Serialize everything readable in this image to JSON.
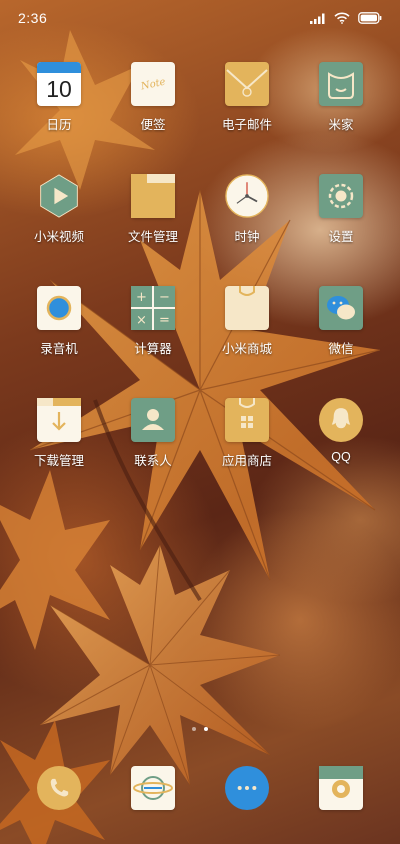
{
  "status_bar": {
    "time": "2:36",
    "icons": [
      "signal-icon",
      "wifi-icon",
      "battery-icon"
    ]
  },
  "apps": [
    {
      "label": "日历",
      "icon": "calendar-icon",
      "badge_text": "10"
    },
    {
      "label": "便签",
      "icon": "notes-icon",
      "badge_text": "Note"
    },
    {
      "label": "电子邮件",
      "icon": "email-icon"
    },
    {
      "label": "米家",
      "icon": "mijia-icon"
    },
    {
      "label": "小米视频",
      "icon": "video-icon"
    },
    {
      "label": "文件管理",
      "icon": "folder-icon"
    },
    {
      "label": "时钟",
      "icon": "clock-icon"
    },
    {
      "label": "设置",
      "icon": "settings-icon"
    },
    {
      "label": "录音机",
      "icon": "recorder-icon"
    },
    {
      "label": "计算器",
      "icon": "calculator-icon"
    },
    {
      "label": "小米商城",
      "icon": "mi-store-icon"
    },
    {
      "label": "微信",
      "icon": "wechat-icon"
    },
    {
      "label": "下载管理",
      "icon": "download-icon"
    },
    {
      "label": "联系人",
      "icon": "contacts-icon"
    },
    {
      "label": "应用商店",
      "icon": "app-store-icon"
    },
    {
      "label": "QQ",
      "icon": "qq-icon"
    }
  ],
  "page_indicator": {
    "pages": 2,
    "current": 2
  },
  "dock": [
    {
      "icon": "phone-icon"
    },
    {
      "icon": "browser-icon"
    },
    {
      "icon": "messages-icon"
    },
    {
      "icon": "camera-icon"
    }
  ],
  "colors": {
    "icon_teal": "#6f9e86",
    "icon_gold": "#e3b45c",
    "icon_cream": "#f6e7c8",
    "accent_blue": "#2f8fdc"
  }
}
